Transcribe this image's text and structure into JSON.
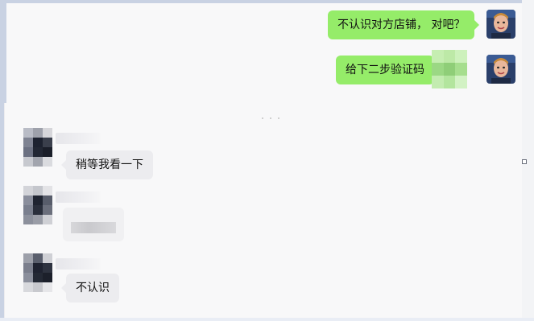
{
  "chat": {
    "messages": [
      {
        "sender": "me",
        "text": "不认识对方店铺， 对吧？"
      },
      {
        "sender": "me",
        "text": "给下二步验证码"
      },
      {
        "sender": "contact",
        "text": "稍等我看一下"
      },
      {
        "sender": "contact",
        "text": ""
      },
      {
        "sender": "contact",
        "text": "不认识"
      }
    ]
  },
  "colors": {
    "my_bubble": "#95ec69",
    "their_bubble": "#ececef",
    "background": "#f8f8f9"
  },
  "icons": {
    "my_avatar": "user-photo-avatar",
    "contact_avatar": "pixelated-avatar"
  }
}
